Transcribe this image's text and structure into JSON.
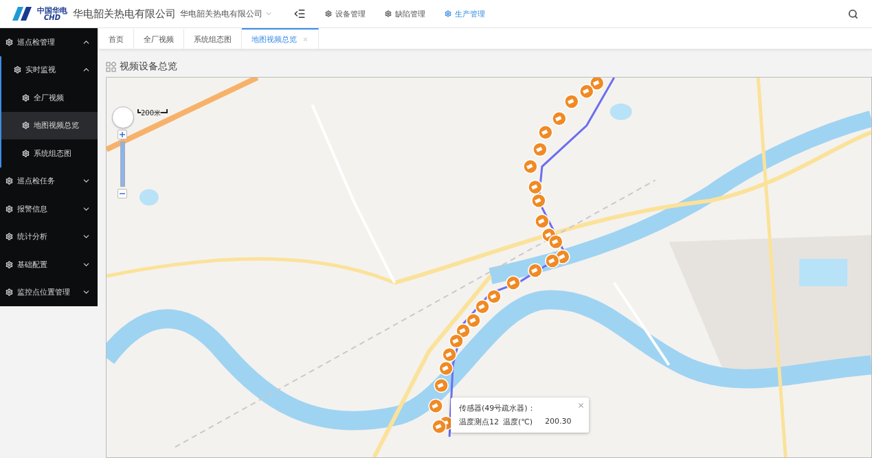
{
  "header": {
    "logo_text": "中国华电",
    "logo_sub": "CHD",
    "company": "华电韶关热电有限公司",
    "org_select": "华电韶关热电有限公司",
    "nav": [
      {
        "label": "设备管理",
        "selected": false
      },
      {
        "label": "缺陷管理",
        "selected": false
      },
      {
        "label": "生产管理",
        "selected": true
      }
    ]
  },
  "sidebar": {
    "items": [
      {
        "label": "巡点检管理",
        "expanded": true,
        "children": [
          {
            "label": "实时监视",
            "expanded": true,
            "children": [
              {
                "label": "全厂视频",
                "selected": false
              },
              {
                "label": "地图视频总览",
                "selected": true
              },
              {
                "label": "系统组态图",
                "selected": false
              }
            ]
          }
        ]
      },
      {
        "label": "巡点检任务",
        "expanded": false
      },
      {
        "label": "报警信息",
        "expanded": false
      },
      {
        "label": "统计分析",
        "expanded": false
      },
      {
        "label": "基础配置",
        "expanded": false
      },
      {
        "label": "监控点位置管理",
        "expanded": false
      }
    ]
  },
  "tabs": [
    {
      "label": "首页",
      "selected": false,
      "closable": false
    },
    {
      "label": "全厂视频",
      "selected": false,
      "closable": false
    },
    {
      "label": "系统组态图",
      "selected": false,
      "closable": false
    },
    {
      "label": "地图视频总览",
      "selected": true,
      "closable": true
    }
  ],
  "panel": {
    "title": "视频设备总览"
  },
  "map": {
    "kind": "picture",
    "scale_label": "200米",
    "popup": {
      "title": "传感器(49号疏水器)：",
      "point": "温度测点12",
      "measure": "温度(℃)",
      "value": "200.30"
    }
  }
}
